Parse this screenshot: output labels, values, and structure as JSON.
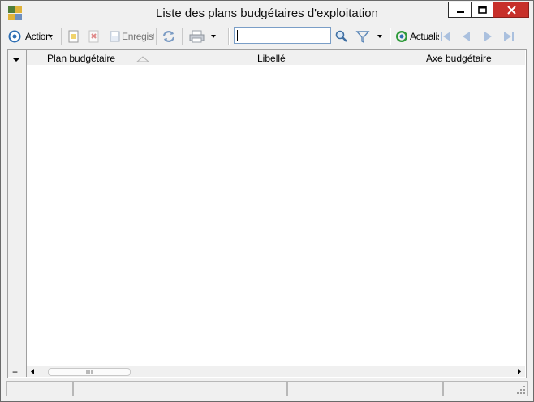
{
  "window": {
    "title": "Liste des plans budgétaires d'exploitation",
    "accent_close": "#c7302a",
    "icons": [
      "app-icon",
      "minimize-icon",
      "maximize-icon",
      "close-icon"
    ]
  },
  "toolbar": {
    "actions_label": "Actions",
    "save_label": "Enregist",
    "refresh_label": "Actualis",
    "search_value": "",
    "icons": [
      "actions-icon",
      "new-record-icon",
      "delete-icon",
      "save-icon",
      "sync-icon",
      "print-icon",
      "search-icon",
      "filter-icon",
      "refresh-icon",
      "first-record-icon",
      "previous-record-icon",
      "next-record-icon",
      "last-record-icon"
    ]
  },
  "grid": {
    "columns": [
      "Plan budgétaire",
      "Libellé",
      "Axe budgétaire"
    ],
    "sorted_column": "Plan budgétaire",
    "sort_direction": "ascending",
    "rows": [],
    "add_row_label": "+"
  },
  "statusbar": {
    "panels": [
      "",
      "",
      "",
      ""
    ]
  }
}
